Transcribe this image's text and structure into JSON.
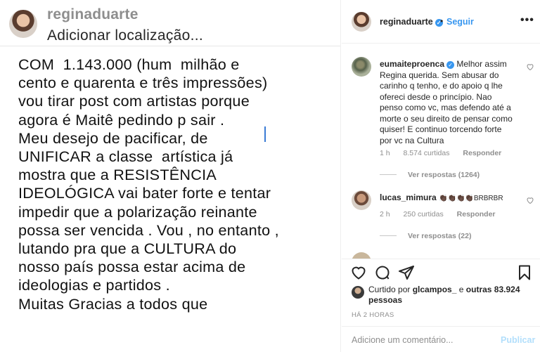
{
  "story": {
    "username": "reginaduarte",
    "location": "Adicionar localização...",
    "text": "COM  1.143.000 (hum  milhão e\ncento e quarenta e três impressões)\nvou tirar post com artistas porque\nagora é Maitê pedindo p sair .\nMeu desejo de pacificar, de\nUNIFICAR a classe  artística já\nmostra que a RESISTÊNCIA\nIDEOLÓGICA vai bater forte e tentar\nimpedir que a polarização reinante\npossa ser vencida . Vou , no entanto ,\nlutando pra que a CULTURA do\nnosso país possa estar acima de\nideologias e partidos .\nMuitas Gracias a todos que"
  },
  "post": {
    "author": "reginaduarte",
    "follow_separator": "•",
    "follow_label": "Seguir",
    "more_icon": "more-options-icon"
  },
  "comments": [
    {
      "user": "eumaiteproenca",
      "verified": true,
      "text": "Melhor assim Regina querida. Sem abusar do carinho q tenho, e do apoio q lhe ofereci desde o princípio. Nao penso como vc, mas defendo até a morte o seu direito de pensar como quiser! E continuo torcendo forte por vc na Cultura",
      "time": "1 h",
      "likes": "8.574 curtidas",
      "reply_label": "Responder",
      "view_replies": "Ver respostas (1264)"
    },
    {
      "user": "lucas_mimura",
      "verified": false,
      "text": "👏🏿👏🏿👏🏿👏🏿BRBRBR",
      "time": "2 h",
      "likes": "250 curtidas",
      "reply_label": "Responder",
      "view_replies": "Ver respostas (22)"
    }
  ],
  "likes": {
    "prefix": "Curtido por",
    "user": "glcampos_",
    "connector": "e",
    "others": "outras 83.924 pessoas"
  },
  "timestamp": "HÁ 2 HORAS",
  "composer": {
    "placeholder": "Adicione um comentário...",
    "publish_label": "Publicar"
  }
}
